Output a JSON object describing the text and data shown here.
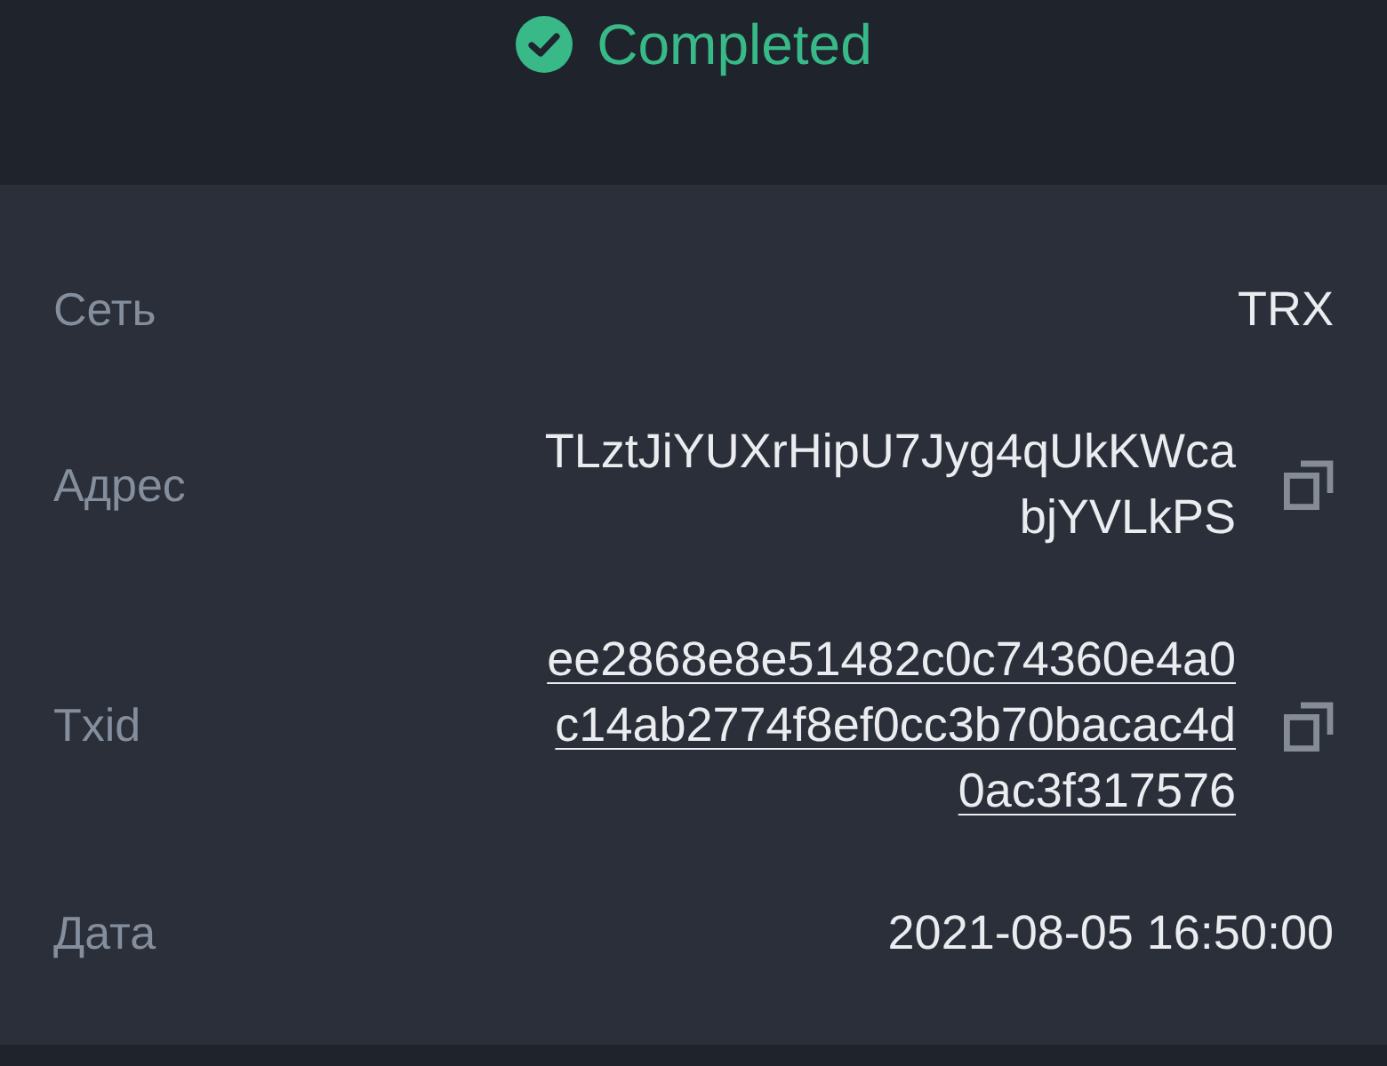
{
  "status": {
    "label": "Completed",
    "kind": "completed"
  },
  "details": [
    {
      "label": "Сеть",
      "value": "TRX",
      "kind": "plain"
    },
    {
      "label": "Адрес",
      "value": "TLztJiYUXrHipU7Jyg4qUkKWcabjYVLkPS",
      "kind": "copy"
    },
    {
      "label": "Txid",
      "value": "ee2868e8e51482c0c74360e4a0c14ab2774f8ef0cc3b70bacac4d0ac3f317576",
      "kind": "link"
    },
    {
      "label": "Дата",
      "value": "2021-08-05 16:50:00",
      "kind": "plain"
    }
  ]
}
